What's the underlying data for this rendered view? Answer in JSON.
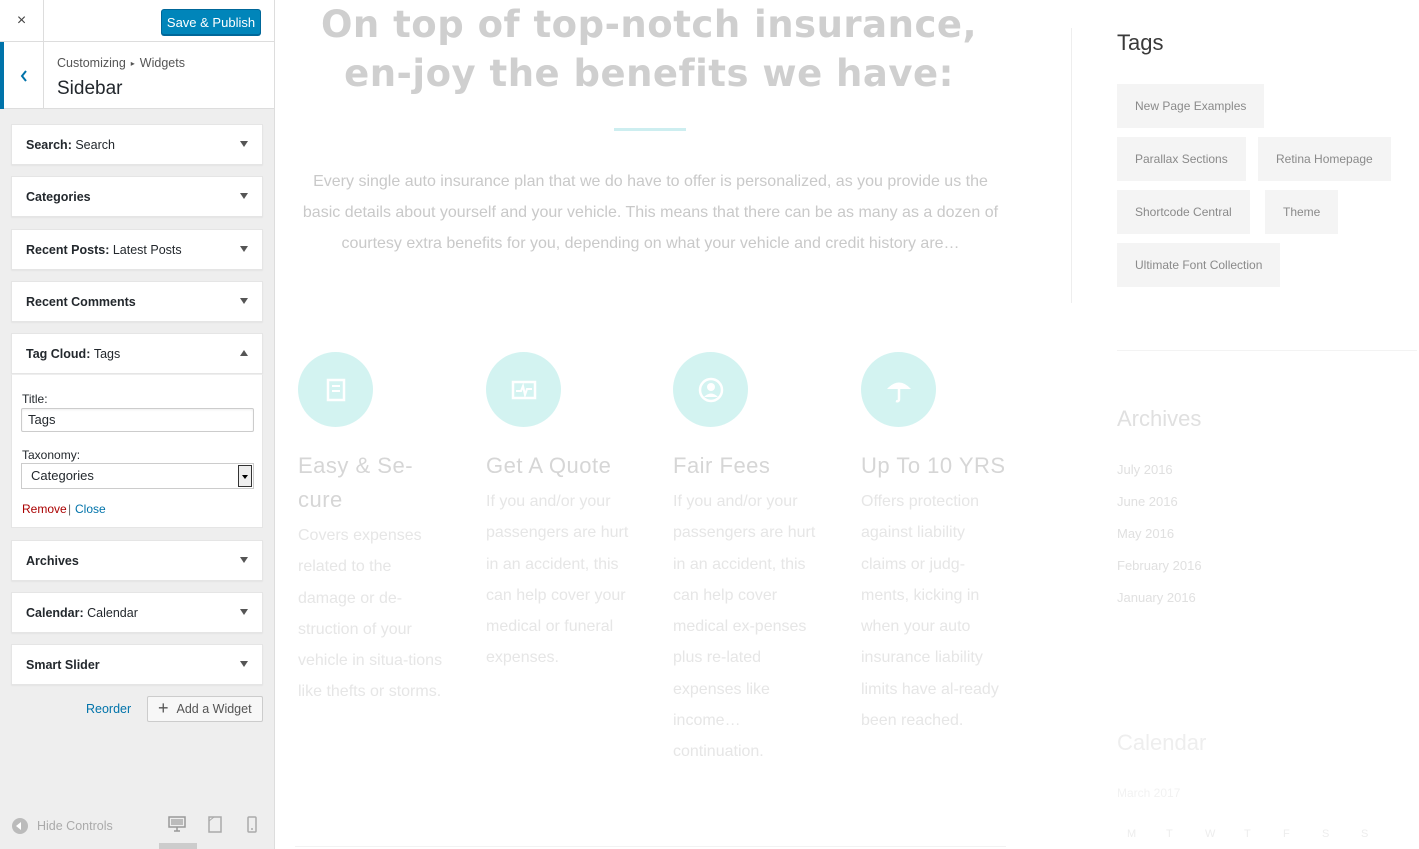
{
  "header": {
    "close_icon": "×",
    "publish_label": "Save & Publish"
  },
  "section": {
    "crumb_root": "Customizing",
    "crumb_sep": "▸",
    "crumb_current": "Widgets",
    "title": "Sidebar"
  },
  "widgets": [
    {
      "label": "Search",
      "sub": "Search"
    },
    {
      "label": "Categories",
      "sub": ""
    },
    {
      "label": "Recent Posts",
      "sub": "Latest Posts"
    },
    {
      "label": "Recent Comments",
      "sub": ""
    },
    {
      "label": "Tag Cloud",
      "sub": "Tags"
    },
    {
      "label": "Archives",
      "sub": ""
    },
    {
      "label": "Calendar",
      "sub": "Calendar"
    },
    {
      "label": "Smart Slider",
      "sub": ""
    }
  ],
  "widget_sub_separator": ": ",
  "tag_cloud_form": {
    "title_label": "Title:",
    "title_value": "Tags",
    "taxonomy_label": "Taxonomy:",
    "taxonomy_value": "Categories",
    "remove_label": "Remove",
    "pipe": "|",
    "close_label": "Close"
  },
  "panel_actions": {
    "reorder_label": "Reorder",
    "add_widget_label": "Add a Widget",
    "plus_icon": "+"
  },
  "footer": {
    "hide_controls_label": "Hide Controls"
  },
  "preview": {
    "headline": "On top of top-notch insurance, en-joy the benefits we have:",
    "intro": "Every single auto insurance plan that we do have to offer is personalized, as you provide us the basic details about yourself and your vehicle. This means that there can be as many as a dozen of courtesy extra benefits for you, depending on what your vehicle and credit history are…",
    "features": [
      {
        "icon": "receipt-icon",
        "title": "Easy & Se-cure",
        "text": "Covers expenses related to the damage or de-struction of your vehicle in situa-tions like thefts or storms."
      },
      {
        "icon": "pulse-icon",
        "title": "Get A Quote",
        "text": "If you and/or your passengers are hurt in an accident, this can help cover your medical or funeral expenses."
      },
      {
        "icon": "user-circle-icon",
        "title": "Fair Fees",
        "text": "If you and/or your passengers are hurt in an accident, this can help cover medical ex-penses plus re-lated expenses like income… continuation."
      },
      {
        "icon": "umbrella-icon",
        "title": "Up To 10 YRS",
        "text": "Offers protection against liability claims or judg-ments, kicking in when your auto insurance liability limits have al-ready been reached."
      }
    ],
    "tags_heading": "Tags",
    "tags": [
      "New Page Examples",
      "Parallax Sections",
      "Retina Homepage",
      "Shortcode Central",
      "Theme",
      "Ultimate Font Collection"
    ],
    "archives_heading": "Archives",
    "archives": [
      "July 2016",
      "June 2016",
      "May 2016",
      "February 2016",
      "January 2016"
    ],
    "calendar_heading": "Calendar",
    "calendar_caption": "March 2017",
    "calendar_days": [
      "M",
      "T",
      "W",
      "T",
      "F",
      "S",
      "S"
    ]
  },
  "colors": {
    "accent": "#0073aa",
    "publish": "#0085ba",
    "remove": "#aa0000",
    "feature_circle": "#d3f3f1"
  }
}
